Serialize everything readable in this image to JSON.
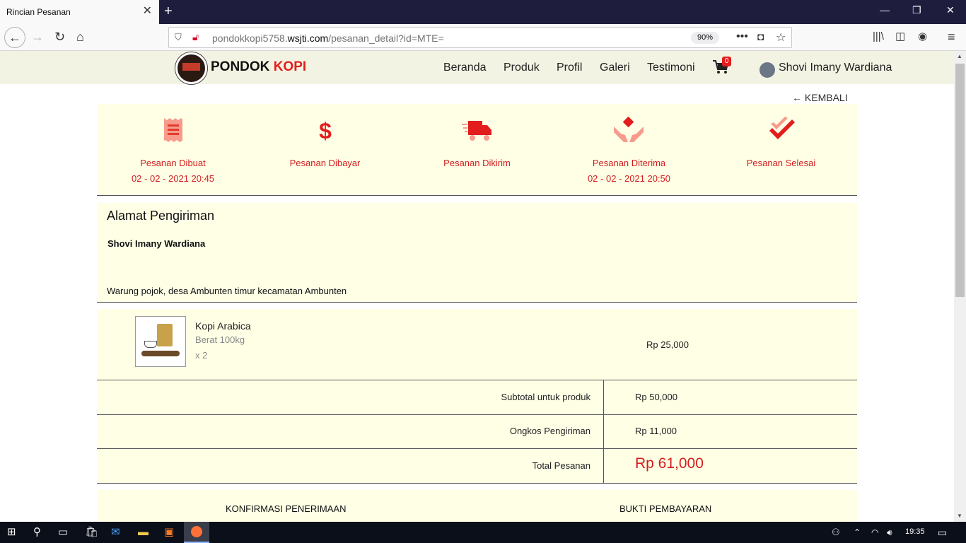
{
  "browser": {
    "tab_title": "Rincian Pesanan",
    "url_prefix": "pondokkopi5758.",
    "url_domain": "wsjti.com",
    "url_path": "/pesanan_detail?id=MTE=",
    "zoom": "90%"
  },
  "site": {
    "brand_1": "PONDOK",
    "brand_2": "KOPI",
    "menu": [
      "Beranda",
      "Produk",
      "Profil",
      "Galeri",
      "Testimoni"
    ],
    "cart_count": "0",
    "user_name": "Shovi Imany Wardiana",
    "back_label": "KEMBALI"
  },
  "steps": [
    {
      "label": "Pesanan Dibuat",
      "date": "02 - 02 - 2021 20:45",
      "icon": "receipt-icon"
    },
    {
      "label": "Pesanan Dibayar",
      "date": "",
      "icon": "dollar-icon"
    },
    {
      "label": "Pesanan Dikirim",
      "date": "",
      "icon": "truck-icon"
    },
    {
      "label": "Pesanan Diterima",
      "date": "02 - 02 - 2021 20:50",
      "icon": "hands-icon"
    },
    {
      "label": "Pesanan Selesai",
      "date": "",
      "icon": "double-check-icon"
    }
  ],
  "address": {
    "title": "Alamat Pengiriman",
    "name": "Shovi Imany Wardiana",
    "text": "Warung pojok, desa Ambunten timur kecamatan Ambunten"
  },
  "product": {
    "name": "Kopi Arabica",
    "weight": "Berat 100kg",
    "qty": "x 2",
    "price": "Rp 25,000"
  },
  "summary": {
    "subtotal_label": "Subtotal untuk produk",
    "subtotal_value": "Rp 50,000",
    "shipping_label": "Ongkos Pengiriman",
    "shipping_value": "Rp 11,000",
    "total_label": "Total Pesanan",
    "total_value": "Rp 61,000"
  },
  "actions": {
    "confirm_label": "KONFIRMASI PENERIMAAN",
    "proof_label": "BUKTI PEMBAYARAN"
  },
  "taskbar": {
    "time": "19:35"
  },
  "colors": {
    "accent": "#d21e1e",
    "panel_bg": "#ffffe6",
    "header_bg": "#f3f3e3"
  }
}
